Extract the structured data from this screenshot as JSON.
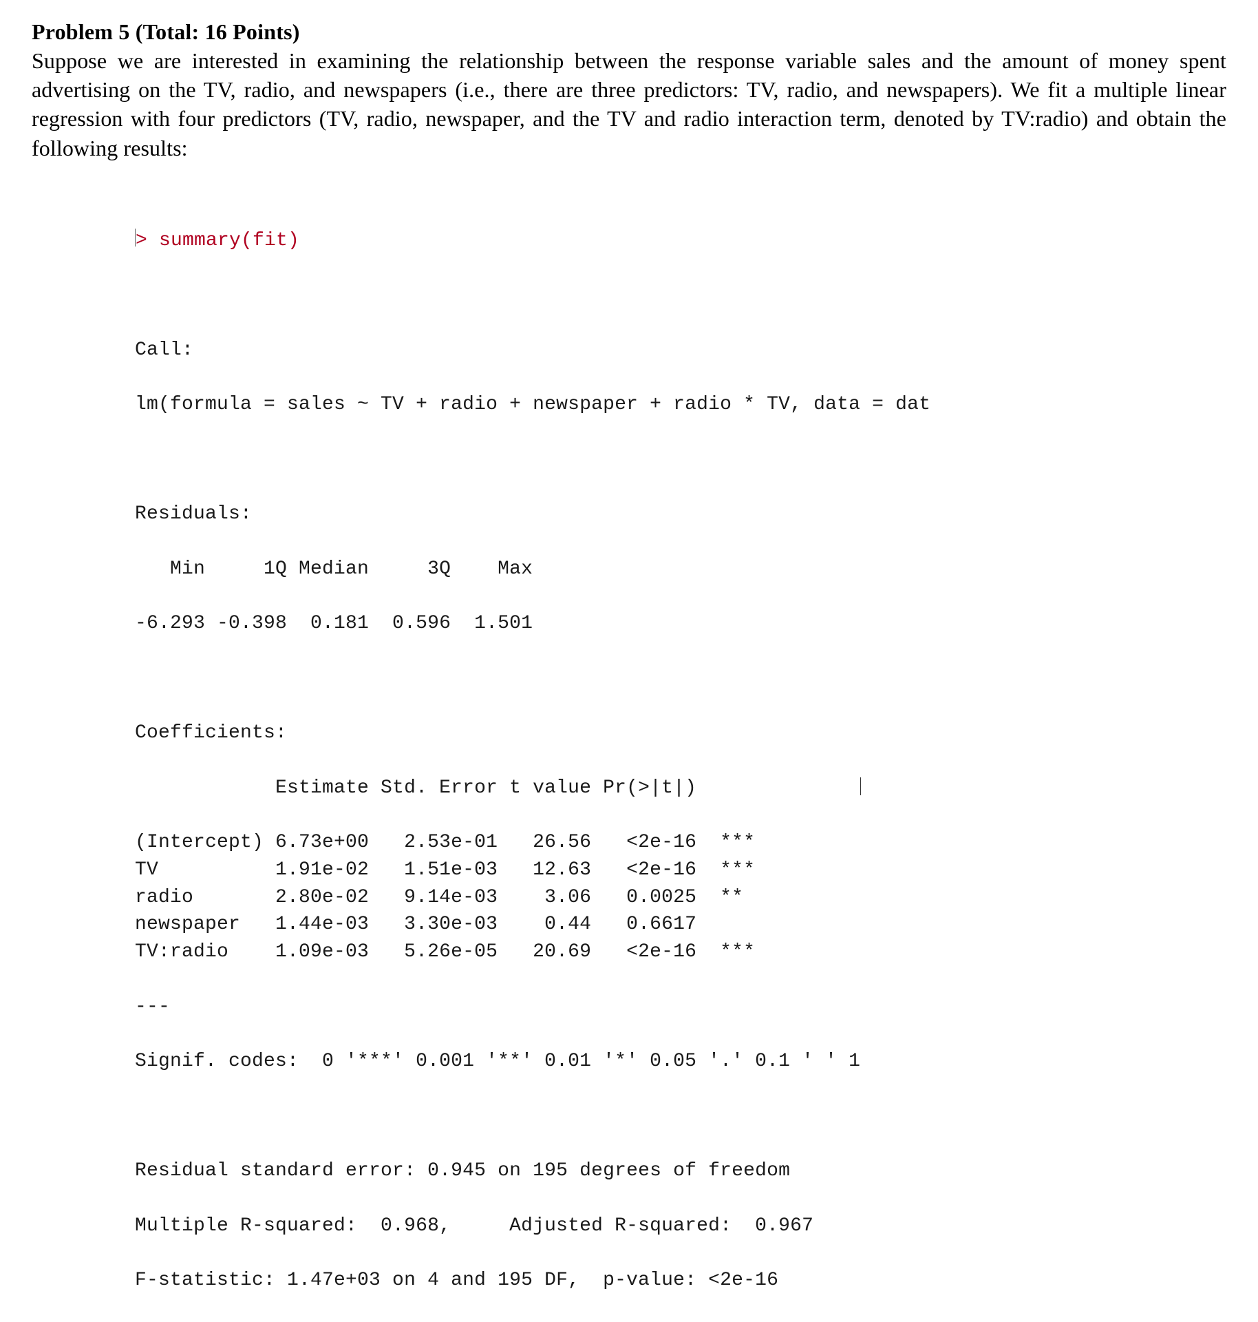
{
  "heading": "Problem 5 (Total: 16 Points)",
  "body": "Suppose we are interested in examining the relationship between the response variable sales and the amount of money spent advertising on the TV, radio, and newspapers (i.e., there are three predictors: TV, radio, and newspapers). We fit a multiple linear regression with four predictors (TV, radio, newspaper, and the TV and radio interaction term, denoted by TV:radio) and obtain the following results:",
  "r_output": {
    "command": "> summary(fit)",
    "call_label": "Call:",
    "call_formula": "lm(formula = sales ~ TV + radio + newspaper + radio * TV, data = dat",
    "residuals_label": "Residuals:",
    "residuals_header": "   Min     1Q Median     3Q    Max",
    "residuals_values": "-6.293 -0.398  0.181  0.596  1.501",
    "coef_label": "Coefficients:",
    "coef_header": "            Estimate Std. Error t value Pr(>|t|)",
    "coef_rows": [
      {
        "name": "(Intercept)",
        "est": "6.73e+00",
        "se": "2.53e-01",
        "t": "26.56",
        "p": "<2e-16",
        "sig": "***"
      },
      {
        "name": "TV",
        "est": "1.91e-02",
        "se": "1.51e-03",
        "t": "12.63",
        "p": "<2e-16",
        "sig": "***"
      },
      {
        "name": "radio",
        "est": "2.80e-02",
        "se": "9.14e-03",
        "t": "3.06",
        "p": "0.0025",
        "sig": "**"
      },
      {
        "name": "newspaper",
        "est": "1.44e-03",
        "se": "3.30e-03",
        "t": "0.44",
        "p": "0.6617",
        "sig": ""
      },
      {
        "name": "TV:radio",
        "est": "1.09e-03",
        "se": "5.26e-05",
        "t": "20.69",
        "p": "<2e-16",
        "sig": "***"
      }
    ],
    "sep": "---",
    "signif_codes": "Signif. codes:  0 '***' 0.001 '**' 0.01 '*' 0.05 '.' 0.1 ' ' 1",
    "rse": "Residual standard error: 0.945 on 195 degrees of freedom",
    "r2": "Multiple R-squared:  0.968,     Adjusted R-squared:  0.967",
    "fstat": "F-statistic: 1.47e+03 on 4 and 195 DF,  p-value: <2e-16"
  }
}
